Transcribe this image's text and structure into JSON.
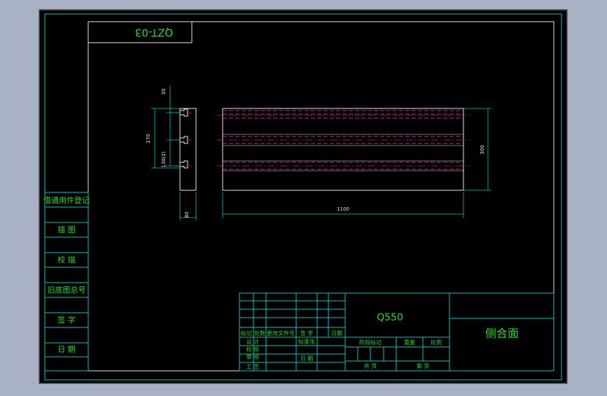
{
  "colors": {
    "background": "#a9b2c4",
    "paper": "#000000",
    "frame": "#00c8c8",
    "text_green": "#22dd22",
    "text_yellow": "#e6e600",
    "dim_white": "#e8e8e8",
    "centerline_red": "#e02020",
    "hidden_magenta": "#e040e0"
  },
  "drawing": {
    "code": "QZT-03",
    "part_name": "侧合面",
    "material": "Q550"
  },
  "dimensions": {
    "side_top": "30",
    "side_pitch": "270",
    "side_lower": "130(2)",
    "side_width": "80",
    "front_length": "1100",
    "front_height": "300"
  },
  "left_strip": [
    "借通用件登记",
    "描  图",
    "校  描",
    "旧底图总号",
    "签  字",
    "日  期"
  ],
  "title_block": {
    "header": [
      "标记",
      "处数",
      "更改文件号",
      "签 字",
      "日期"
    ],
    "roles": [
      "设 计",
      "校 核",
      "审 核",
      "批 准",
      "工 艺"
    ],
    "role_notes": [
      "标准化",
      "日 期"
    ],
    "stage_labels": [
      "阶段标记",
      "重量",
      "比例"
    ],
    "sheet_labels": [
      "共   页",
      "第   页"
    ]
  }
}
